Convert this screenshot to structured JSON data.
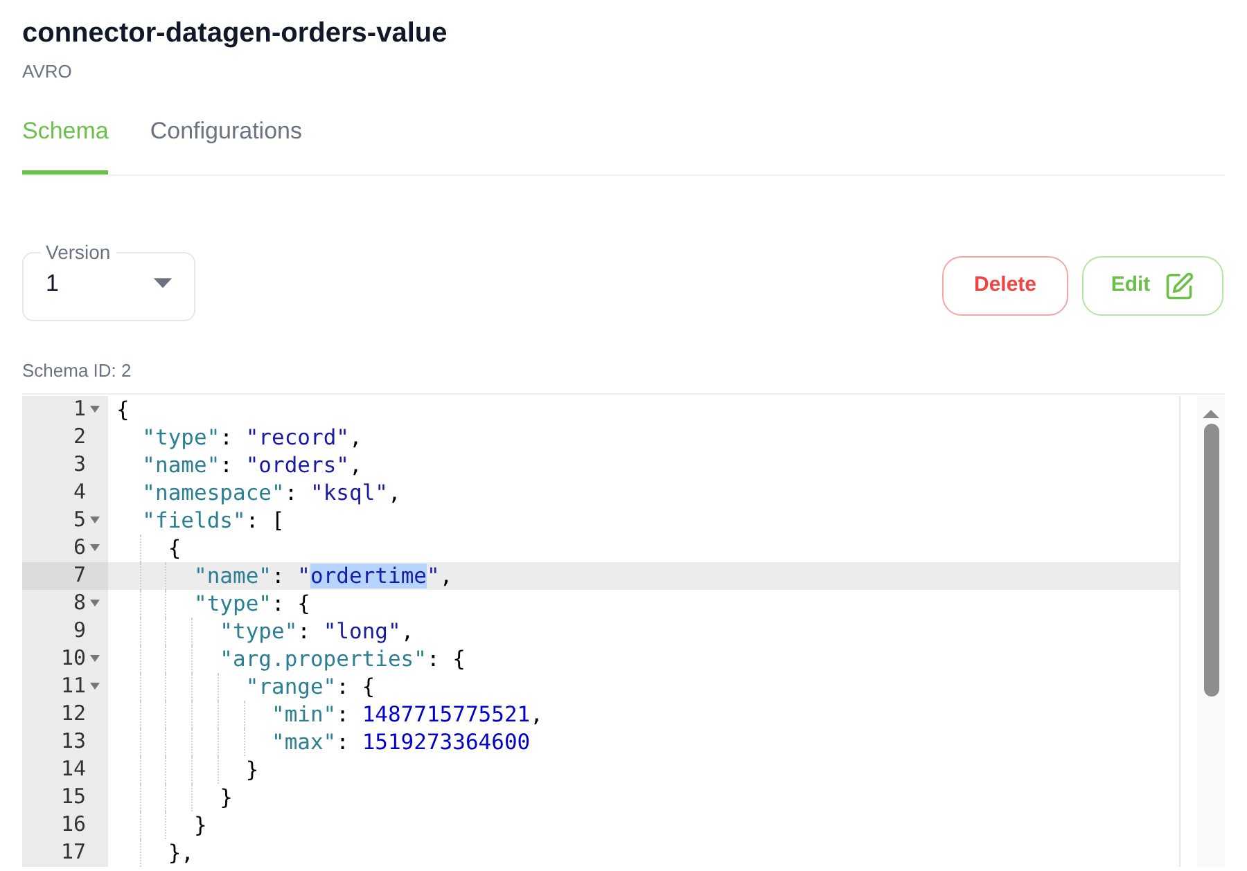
{
  "title": "connector-datagen-orders-value",
  "format": "AVRO",
  "tabs": [
    {
      "label": "Schema",
      "selected": true
    },
    {
      "label": "Configurations",
      "selected": false
    }
  ],
  "version_select": {
    "label": "Version",
    "value": "1"
  },
  "buttons": [
    {
      "kind": "danger",
      "label": "Delete"
    },
    {
      "kind": "edit",
      "label": "Edit"
    }
  ],
  "schema_id": "Schema ID: 2",
  "editor": {
    "lines": [
      {
        "number": "1",
        "foldable": true,
        "active": false,
        "tokens": [
          {
            "kind": "punct",
            "text": "{"
          }
        ]
      },
      {
        "number": "2",
        "foldable": false,
        "active": false,
        "tokens": [
          {
            "kind": "key",
            "text": "  \"type\""
          },
          {
            "kind": "punct",
            "text": ": "
          },
          {
            "kind": "string",
            "text": "\"record\""
          },
          {
            "kind": "punct",
            "text": ","
          }
        ]
      },
      {
        "number": "3",
        "foldable": false,
        "active": false,
        "tokens": [
          {
            "kind": "key",
            "text": "  \"name\""
          },
          {
            "kind": "punct",
            "text": ": "
          },
          {
            "kind": "string",
            "text": "\"orders\""
          },
          {
            "kind": "punct",
            "text": ","
          }
        ]
      },
      {
        "number": "4",
        "foldable": false,
        "active": false,
        "tokens": [
          {
            "kind": "key",
            "text": "  \"namespace\""
          },
          {
            "kind": "punct",
            "text": ": "
          },
          {
            "kind": "string",
            "text": "\"ksql\""
          },
          {
            "kind": "punct",
            "text": ","
          }
        ]
      },
      {
        "number": "5",
        "foldable": true,
        "active": false,
        "tokens": [
          {
            "kind": "key",
            "text": "  \"fields\""
          },
          {
            "kind": "punct",
            "text": ": ["
          }
        ]
      },
      {
        "number": "6",
        "foldable": true,
        "active": false,
        "tokens": [
          {
            "kind": "punct",
            "text": "    {"
          }
        ]
      },
      {
        "number": "7",
        "foldable": false,
        "active": true,
        "tokens": [
          {
            "kind": "key",
            "text": "      \"name\""
          },
          {
            "kind": "punct",
            "text": ": "
          },
          {
            "kind": "string",
            "text": "\""
          },
          {
            "kind": "selection",
            "text": "ordertime"
          },
          {
            "kind": "string",
            "text": "\""
          },
          {
            "kind": "punct",
            "text": ","
          }
        ]
      },
      {
        "number": "8",
        "foldable": true,
        "active": false,
        "tokens": [
          {
            "kind": "key",
            "text": "      \"type\""
          },
          {
            "kind": "punct",
            "text": ": {"
          }
        ]
      },
      {
        "number": "9",
        "foldable": false,
        "active": false,
        "tokens": [
          {
            "kind": "key",
            "text": "        \"type\""
          },
          {
            "kind": "punct",
            "text": ": "
          },
          {
            "kind": "string",
            "text": "\"long\""
          },
          {
            "kind": "punct",
            "text": ","
          }
        ]
      },
      {
        "number": "10",
        "foldable": true,
        "active": false,
        "tokens": [
          {
            "kind": "key",
            "text": "        \"arg.properties\""
          },
          {
            "kind": "punct",
            "text": ": {"
          }
        ]
      },
      {
        "number": "11",
        "foldable": true,
        "active": false,
        "tokens": [
          {
            "kind": "key",
            "text": "          \"range\""
          },
          {
            "kind": "punct",
            "text": ": {"
          }
        ]
      },
      {
        "number": "12",
        "foldable": false,
        "active": false,
        "tokens": [
          {
            "kind": "key",
            "text": "            \"min\""
          },
          {
            "kind": "punct",
            "text": ": "
          },
          {
            "kind": "number",
            "text": "1487715775521"
          },
          {
            "kind": "punct",
            "text": ","
          }
        ]
      },
      {
        "number": "13",
        "foldable": false,
        "active": false,
        "tokens": [
          {
            "kind": "key",
            "text": "            \"max\""
          },
          {
            "kind": "punct",
            "text": ": "
          },
          {
            "kind": "number",
            "text": "1519273364600"
          }
        ]
      },
      {
        "number": "14",
        "foldable": false,
        "active": false,
        "tokens": [
          {
            "kind": "punct",
            "text": "          }"
          }
        ]
      },
      {
        "number": "15",
        "foldable": false,
        "active": false,
        "tokens": [
          {
            "kind": "punct",
            "text": "        }"
          }
        ]
      },
      {
        "number": "16",
        "foldable": false,
        "active": false,
        "tokens": [
          {
            "kind": "punct",
            "text": "      }"
          }
        ]
      },
      {
        "number": "17",
        "foldable": false,
        "active": false,
        "tokens": [
          {
            "kind": "punct",
            "text": "    },"
          }
        ]
      }
    ]
  }
}
